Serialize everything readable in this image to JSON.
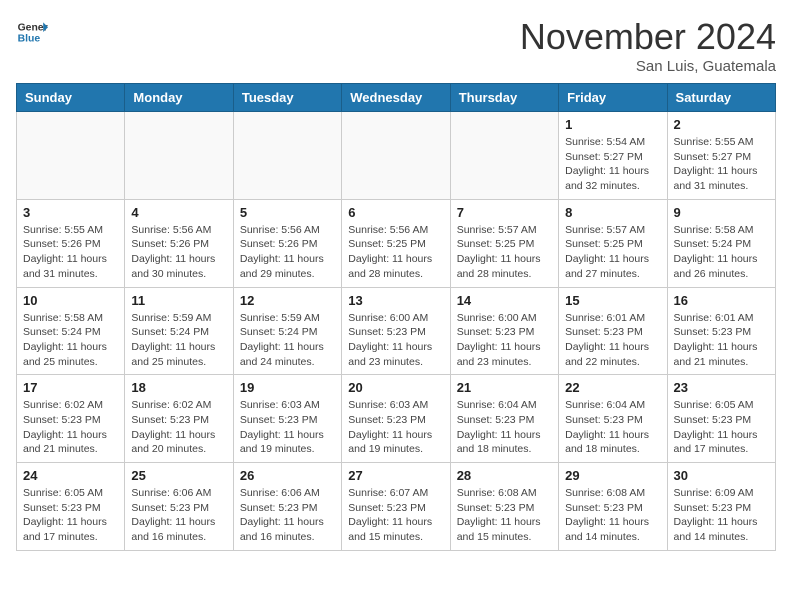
{
  "header": {
    "logo_general": "General",
    "logo_blue": "Blue",
    "month_title": "November 2024",
    "location": "San Luis, Guatemala"
  },
  "weekdays": [
    "Sunday",
    "Monday",
    "Tuesday",
    "Wednesday",
    "Thursday",
    "Friday",
    "Saturday"
  ],
  "weeks": [
    [
      {
        "day": "",
        "info": ""
      },
      {
        "day": "",
        "info": ""
      },
      {
        "day": "",
        "info": ""
      },
      {
        "day": "",
        "info": ""
      },
      {
        "day": "",
        "info": ""
      },
      {
        "day": "1",
        "info": "Sunrise: 5:54 AM\nSunset: 5:27 PM\nDaylight: 11 hours\nand 32 minutes."
      },
      {
        "day": "2",
        "info": "Sunrise: 5:55 AM\nSunset: 5:27 PM\nDaylight: 11 hours\nand 31 minutes."
      }
    ],
    [
      {
        "day": "3",
        "info": "Sunrise: 5:55 AM\nSunset: 5:26 PM\nDaylight: 11 hours\nand 31 minutes."
      },
      {
        "day": "4",
        "info": "Sunrise: 5:56 AM\nSunset: 5:26 PM\nDaylight: 11 hours\nand 30 minutes."
      },
      {
        "day": "5",
        "info": "Sunrise: 5:56 AM\nSunset: 5:26 PM\nDaylight: 11 hours\nand 29 minutes."
      },
      {
        "day": "6",
        "info": "Sunrise: 5:56 AM\nSunset: 5:25 PM\nDaylight: 11 hours\nand 28 minutes."
      },
      {
        "day": "7",
        "info": "Sunrise: 5:57 AM\nSunset: 5:25 PM\nDaylight: 11 hours\nand 28 minutes."
      },
      {
        "day": "8",
        "info": "Sunrise: 5:57 AM\nSunset: 5:25 PM\nDaylight: 11 hours\nand 27 minutes."
      },
      {
        "day": "9",
        "info": "Sunrise: 5:58 AM\nSunset: 5:24 PM\nDaylight: 11 hours\nand 26 minutes."
      }
    ],
    [
      {
        "day": "10",
        "info": "Sunrise: 5:58 AM\nSunset: 5:24 PM\nDaylight: 11 hours\nand 25 minutes."
      },
      {
        "day": "11",
        "info": "Sunrise: 5:59 AM\nSunset: 5:24 PM\nDaylight: 11 hours\nand 25 minutes."
      },
      {
        "day": "12",
        "info": "Sunrise: 5:59 AM\nSunset: 5:24 PM\nDaylight: 11 hours\nand 24 minutes."
      },
      {
        "day": "13",
        "info": "Sunrise: 6:00 AM\nSunset: 5:23 PM\nDaylight: 11 hours\nand 23 minutes."
      },
      {
        "day": "14",
        "info": "Sunrise: 6:00 AM\nSunset: 5:23 PM\nDaylight: 11 hours\nand 23 minutes."
      },
      {
        "day": "15",
        "info": "Sunrise: 6:01 AM\nSunset: 5:23 PM\nDaylight: 11 hours\nand 22 minutes."
      },
      {
        "day": "16",
        "info": "Sunrise: 6:01 AM\nSunset: 5:23 PM\nDaylight: 11 hours\nand 21 minutes."
      }
    ],
    [
      {
        "day": "17",
        "info": "Sunrise: 6:02 AM\nSunset: 5:23 PM\nDaylight: 11 hours\nand 21 minutes."
      },
      {
        "day": "18",
        "info": "Sunrise: 6:02 AM\nSunset: 5:23 PM\nDaylight: 11 hours\nand 20 minutes."
      },
      {
        "day": "19",
        "info": "Sunrise: 6:03 AM\nSunset: 5:23 PM\nDaylight: 11 hours\nand 19 minutes."
      },
      {
        "day": "20",
        "info": "Sunrise: 6:03 AM\nSunset: 5:23 PM\nDaylight: 11 hours\nand 19 minutes."
      },
      {
        "day": "21",
        "info": "Sunrise: 6:04 AM\nSunset: 5:23 PM\nDaylight: 11 hours\nand 18 minutes."
      },
      {
        "day": "22",
        "info": "Sunrise: 6:04 AM\nSunset: 5:23 PM\nDaylight: 11 hours\nand 18 minutes."
      },
      {
        "day": "23",
        "info": "Sunrise: 6:05 AM\nSunset: 5:23 PM\nDaylight: 11 hours\nand 17 minutes."
      }
    ],
    [
      {
        "day": "24",
        "info": "Sunrise: 6:05 AM\nSunset: 5:23 PM\nDaylight: 11 hours\nand 17 minutes."
      },
      {
        "day": "25",
        "info": "Sunrise: 6:06 AM\nSunset: 5:23 PM\nDaylight: 11 hours\nand 16 minutes."
      },
      {
        "day": "26",
        "info": "Sunrise: 6:06 AM\nSunset: 5:23 PM\nDaylight: 11 hours\nand 16 minutes."
      },
      {
        "day": "27",
        "info": "Sunrise: 6:07 AM\nSunset: 5:23 PM\nDaylight: 11 hours\nand 15 minutes."
      },
      {
        "day": "28",
        "info": "Sunrise: 6:08 AM\nSunset: 5:23 PM\nDaylight: 11 hours\nand 15 minutes."
      },
      {
        "day": "29",
        "info": "Sunrise: 6:08 AM\nSunset: 5:23 PM\nDaylight: 11 hours\nand 14 minutes."
      },
      {
        "day": "30",
        "info": "Sunrise: 6:09 AM\nSunset: 5:23 PM\nDaylight: 11 hours\nand 14 minutes."
      }
    ]
  ]
}
